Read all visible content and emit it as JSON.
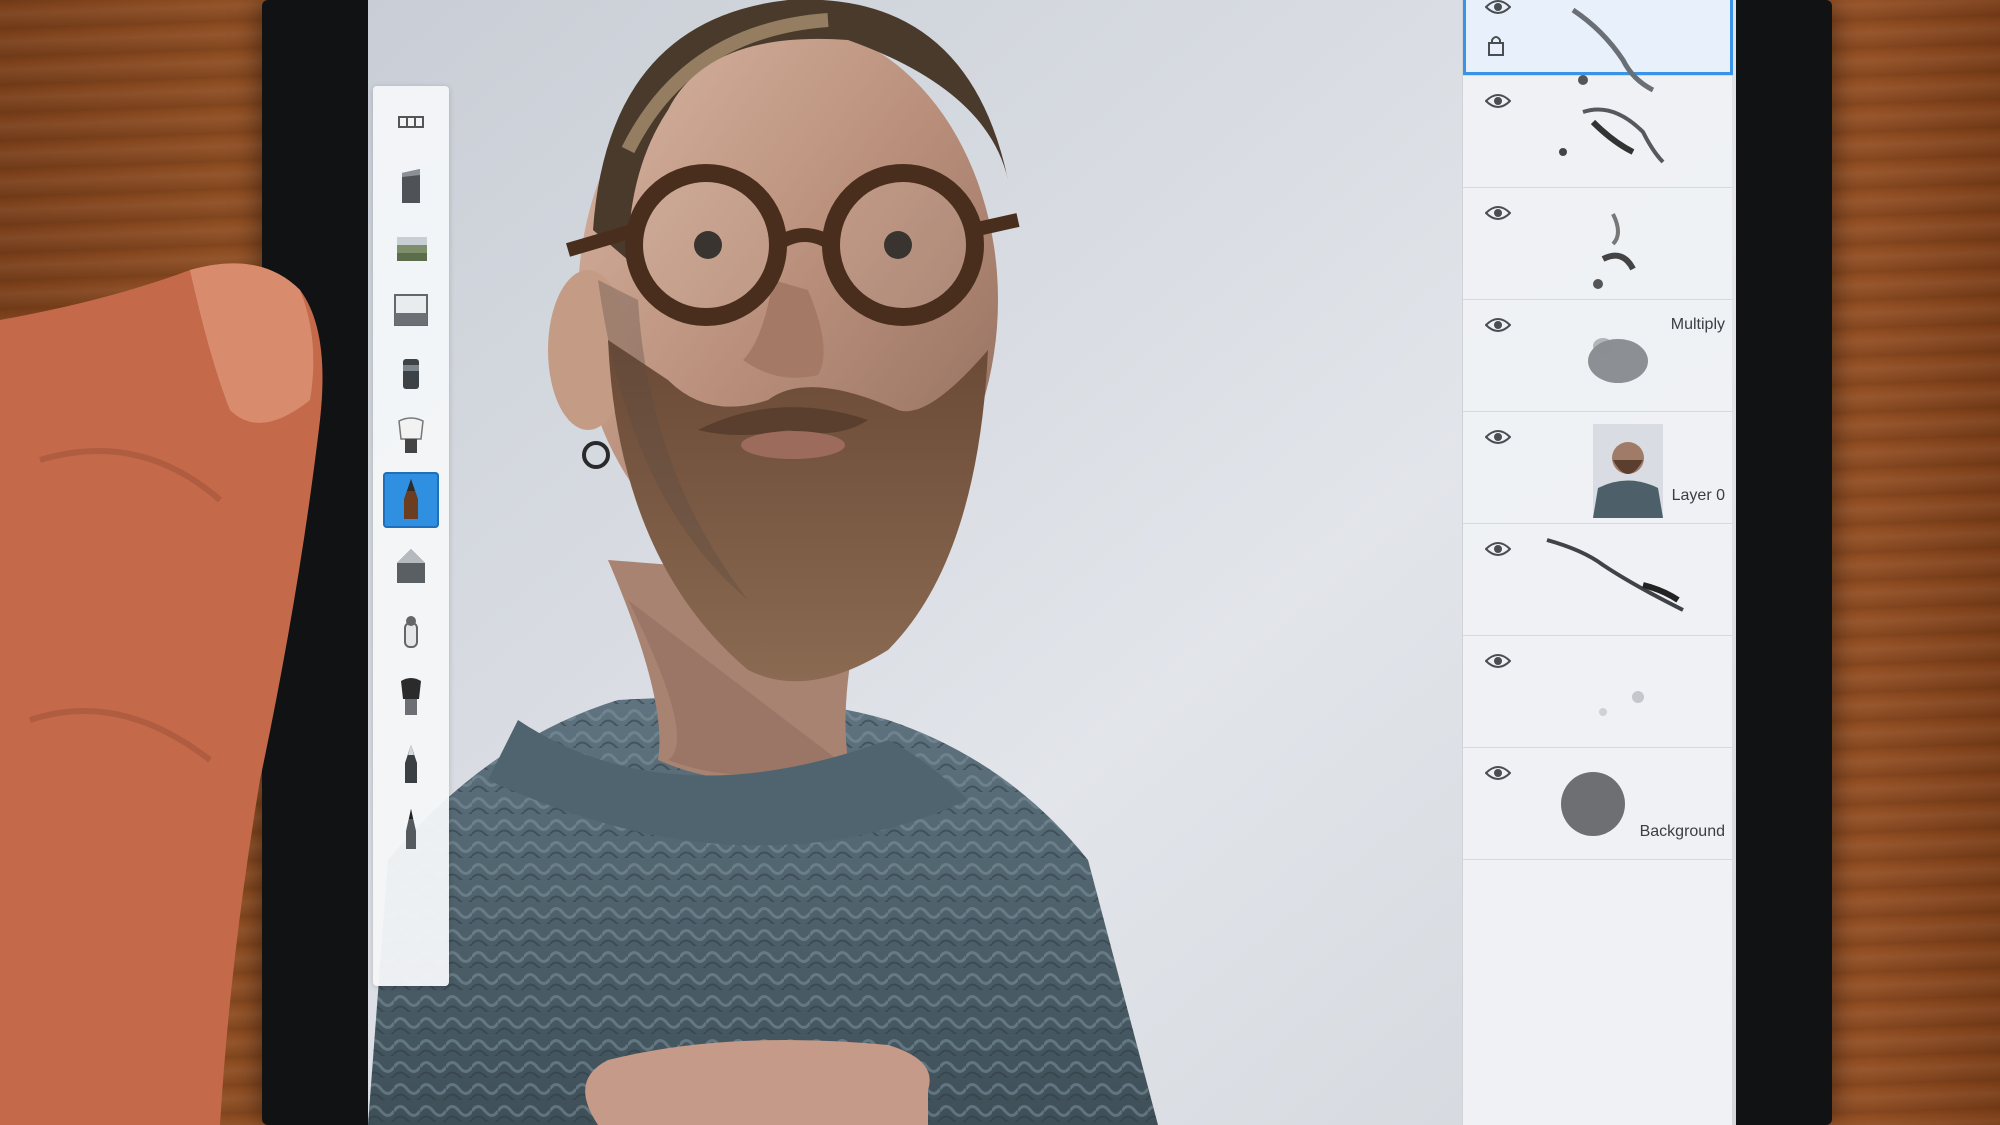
{
  "app": {
    "name": ""
  },
  "toolbar": {
    "tools": [
      {
        "name": "brush-library-icon",
        "active": false
      },
      {
        "name": "block-brush-icon",
        "active": false
      },
      {
        "name": "texture-brush-icon",
        "active": false
      },
      {
        "name": "gradient-brush-icon",
        "active": false
      },
      {
        "name": "marker-brush-icon",
        "active": false
      },
      {
        "name": "paint-brush-icon",
        "active": false
      },
      {
        "name": "pencil-brush-icon",
        "active": true
      },
      {
        "name": "chisel-brush-icon",
        "active": false
      },
      {
        "name": "smudge-brush-icon",
        "active": false
      },
      {
        "name": "airbrush-icon",
        "active": false
      },
      {
        "name": "ink-pen-icon",
        "active": false
      },
      {
        "name": "fine-pen-icon",
        "active": false
      }
    ]
  },
  "layers": [
    {
      "label": "",
      "selected": true,
      "thumb": "sketch-strokes-top"
    },
    {
      "label": "",
      "selected": false,
      "thumb": "sketch-strokes"
    },
    {
      "label": "",
      "selected": false,
      "thumb": "sketch-marks"
    },
    {
      "label": "Multiply",
      "selected": false,
      "thumb": "shadow-wash"
    },
    {
      "label": "Layer 0",
      "selected": false,
      "thumb": "portrait-photo"
    },
    {
      "label": "",
      "selected": false,
      "thumb": "diagonal-stroke"
    },
    {
      "label": "",
      "selected": false,
      "thumb": "faint-marks"
    },
    {
      "label": "Background",
      "selected": false,
      "thumb": "grey-circle"
    }
  ],
  "colors": {
    "accent": "#2f8fe0",
    "panel": "#f0f2f5",
    "canvas_bg": "#d9dde3",
    "background_swatch": "#6e6f73"
  }
}
